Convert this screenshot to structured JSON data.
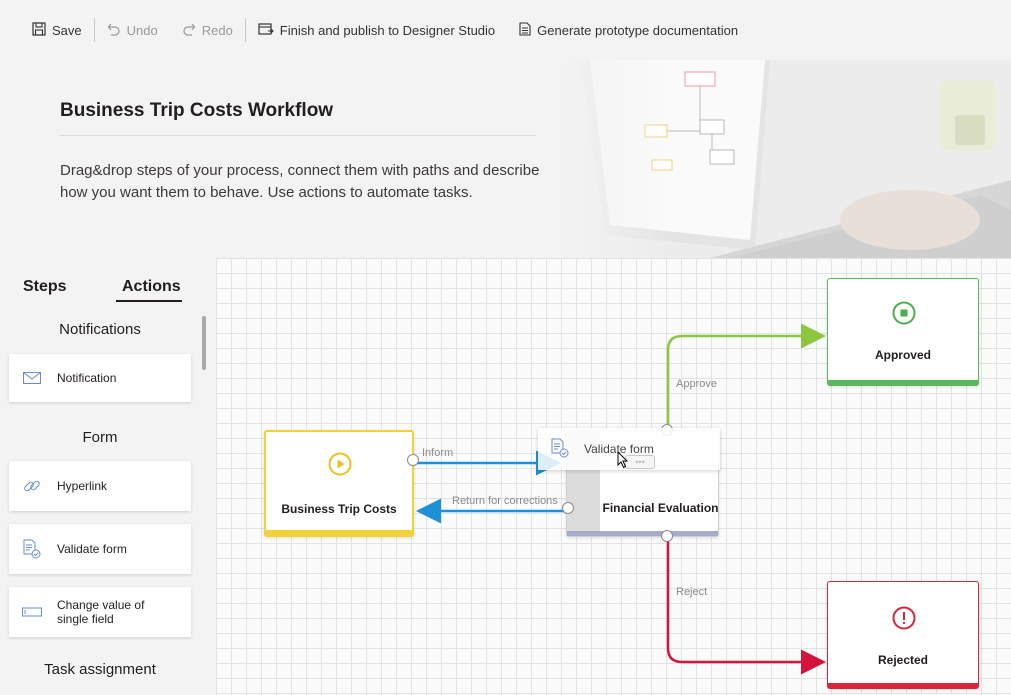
{
  "toolbar": {
    "save": "Save",
    "undo": "Undo",
    "redo": "Redo",
    "finish": "Finish and publish to Designer Studio",
    "docs": "Generate prototype documentation"
  },
  "hero": {
    "title": "Business Trip Costs Workflow",
    "description": "Drag&drop steps of your process, connect them with paths and describe how you want them to behave. Use actions to automate tasks."
  },
  "panel": {
    "tabs": [
      "Steps",
      "Actions"
    ],
    "active_tab": "Actions",
    "sections": {
      "notifications": "Notifications",
      "form": "Form",
      "task_assignment": "Task assignment"
    },
    "items": {
      "notification": "Notification",
      "hyperlink": "Hyperlink",
      "validate_form": "Validate form",
      "change_value": "Change value of single field"
    }
  },
  "canvas": {
    "nodes": {
      "start": "Business Trip Costs",
      "evaluation": "Financial Evaluation",
      "approved": "Approved",
      "rejected": "Rejected"
    },
    "edges": {
      "inform": "Inform",
      "return": "Return for corrections",
      "approve": "Approve",
      "reject": "Reject"
    },
    "dragging": "Validate form"
  },
  "colors": {
    "start": "#f2d13a",
    "evaluation": "#a6acc8",
    "approved": "#5cb85c",
    "rejected": "#d9243a",
    "blue_edge": "#1e90d8",
    "green_edge": "#8cc63f",
    "red_edge": "#d4143c"
  }
}
